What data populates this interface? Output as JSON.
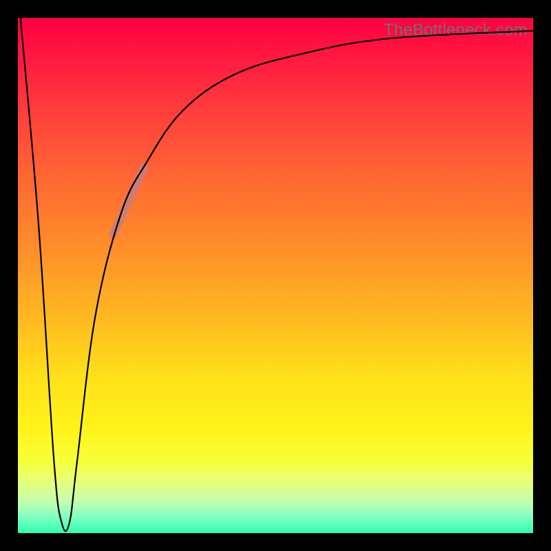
{
  "watermark": "TheBottleneck.com",
  "chart_data": {
    "type": "line",
    "title": "",
    "xlabel": "",
    "ylabel": "",
    "xlim": [
      0,
      100
    ],
    "ylim": [
      0,
      100
    ],
    "grid": false,
    "legend": false,
    "series": [
      {
        "name": "bottleneck-curve",
        "color": "#000000",
        "points": [
          {
            "x": 0.5,
            "y": 100
          },
          {
            "x": 4.0,
            "y": 60
          },
          {
            "x": 7.0,
            "y": 14
          },
          {
            "x": 8.5,
            "y": 2
          },
          {
            "x": 10.0,
            "y": 2
          },
          {
            "x": 11.5,
            "y": 14
          },
          {
            "x": 15.0,
            "y": 42
          },
          {
            "x": 20.0,
            "y": 62
          },
          {
            "x": 25.0,
            "y": 72
          },
          {
            "x": 32.0,
            "y": 82
          },
          {
            "x": 42.0,
            "y": 89
          },
          {
            "x": 55.0,
            "y": 93
          },
          {
            "x": 72.0,
            "y": 96
          },
          {
            "x": 100.0,
            "y": 97.5
          }
        ]
      }
    ],
    "highlight": {
      "name": "marker-segment",
      "color": "#c67d80",
      "points": [
        {
          "x": 18.5,
          "y": 58
        },
        {
          "x": 24.5,
          "y": 71
        }
      ]
    },
    "background_gradient": {
      "top": "#ff0041",
      "bottom": "#2cffb0"
    }
  }
}
